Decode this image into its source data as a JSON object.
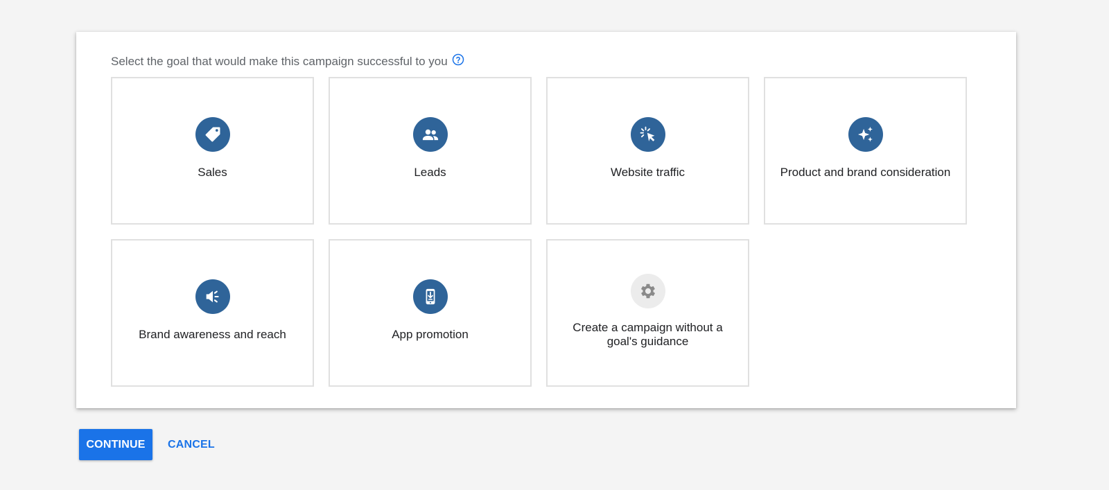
{
  "prompt": {
    "text": "Select the goal that would make this campaign successful to you",
    "help_icon": "help-circle-icon"
  },
  "colors": {
    "icon_circle": "#2f6499",
    "icon_circle_disabled": "#ececec",
    "primary": "#1a73e8",
    "tile_border": "#e0e0e0",
    "background": "#f4f4f4"
  },
  "goals": [
    {
      "label": "Sales",
      "icon": "tag-icon"
    },
    {
      "label": "Leads",
      "icon": "people-icon"
    },
    {
      "label": "Website traffic",
      "icon": "cursor-click-icon"
    },
    {
      "label": "Product and brand consideration",
      "icon": "sparkle-icon"
    },
    {
      "label": "Brand awareness and reach",
      "icon": "megaphone-icon"
    },
    {
      "label": "App promotion",
      "icon": "phone-download-icon"
    },
    {
      "label": "Create a campaign without a goal's guidance",
      "icon": "gear-icon"
    }
  ],
  "actions": {
    "continue_label": "CONTINUE",
    "cancel_label": "CANCEL"
  }
}
